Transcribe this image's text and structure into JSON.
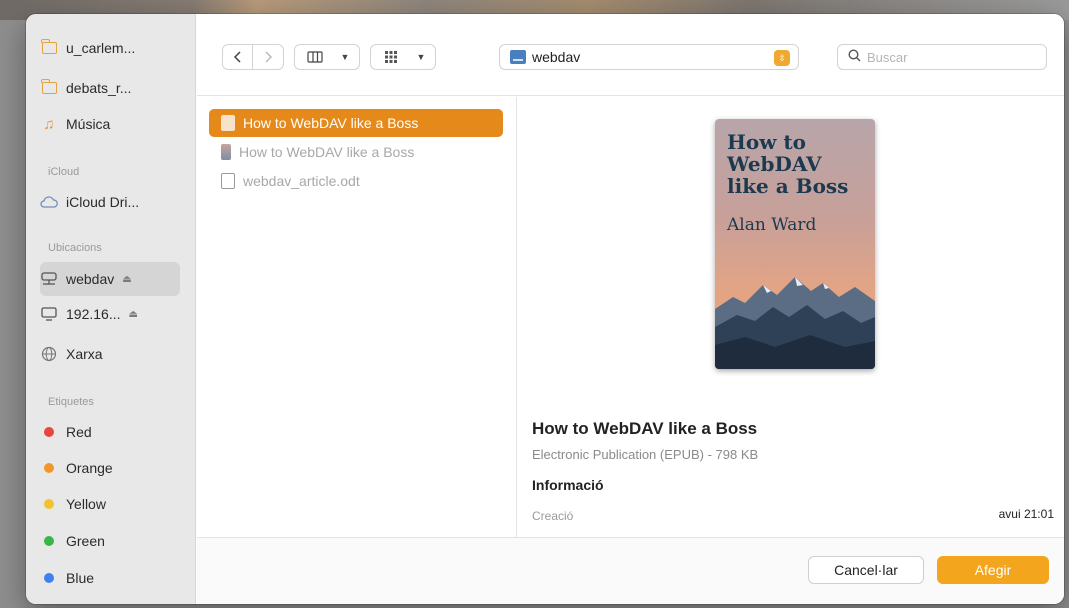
{
  "sidebar": {
    "top_items": [
      {
        "label": "u_carlem...",
        "icon": "folder-icon"
      },
      {
        "label": "debats_r...",
        "icon": "folder-icon"
      },
      {
        "label": "Música",
        "icon": "music-icon"
      }
    ],
    "icloud_header": "iCloud",
    "icloud_items": [
      {
        "label": "iCloud Dri...",
        "icon": "cloud-icon"
      }
    ],
    "locations_header": "Ubicacions",
    "locations": [
      {
        "label": "webdav",
        "icon": "network-drive-icon"
      },
      {
        "label": "192.16...",
        "icon": "display-icon"
      },
      {
        "label": "Xarxa",
        "icon": "globe-icon"
      }
    ],
    "tags_header": "Etiquetes",
    "tags": [
      {
        "label": "Red",
        "color": "#e8453c"
      },
      {
        "label": "Orange",
        "color": "#f0972b"
      },
      {
        "label": "Yellow",
        "color": "#f2c230"
      },
      {
        "label": "Green",
        "color": "#3bb54a"
      },
      {
        "label": "Blue",
        "color": "#3b82f0"
      }
    ]
  },
  "toolbar": {
    "back_icon": "chevron-left-icon",
    "forward_icon": "chevron-right-icon",
    "view_icon": "columns-view-icon",
    "group_icon": "grid-icon",
    "location": "webdav",
    "search_placeholder": "Buscar"
  },
  "files": [
    {
      "name": "How to WebDAV like a Boss",
      "selected": true
    },
    {
      "name": "How to WebDAV like a Boss",
      "selected": false
    },
    {
      "name": "webdav_article.odt",
      "selected": false
    }
  ],
  "preview": {
    "cover_title": "How to WebDAV like a Boss",
    "cover_author": "Alan Ward",
    "name": "How to WebDAV like a Boss",
    "kind": "Electronic Publication (EPUB) - 798 KB",
    "info_header": "Informació",
    "created_label": "Creació",
    "created_value": "avui 21:01"
  },
  "buttons": {
    "cancel": "Cancel·lar",
    "add": "Afegir"
  },
  "colors": {
    "accent": "#e58a1a",
    "primary_button": "#f3a51d"
  }
}
